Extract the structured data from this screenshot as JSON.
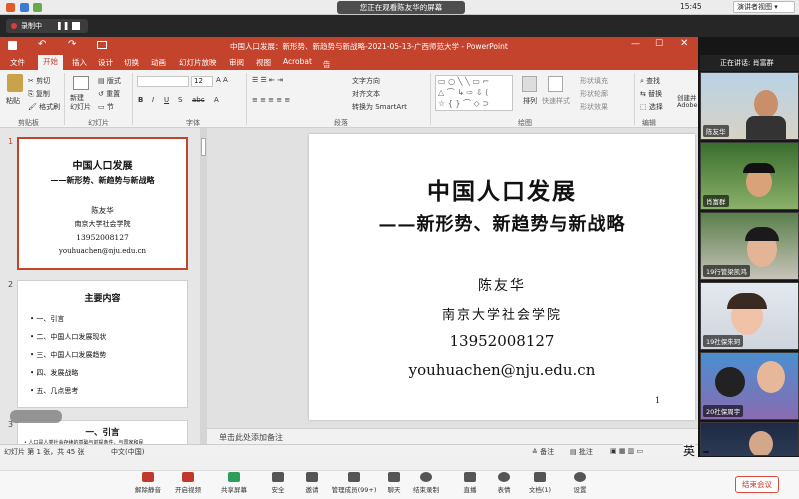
{
  "mac_bar": {
    "viewing_banner": "您正在观看陈友华的屏幕",
    "clock": "15:45",
    "view_options": "演讲者视图 ▾"
  },
  "recording": {
    "label": "录制中"
  },
  "ppt": {
    "window_title": "中国人口发展：新形势、新趋势与新战略-2021-05-13-广西师范大学 - PowerPoint",
    "tabs": [
      "文件",
      "开始",
      "插入",
      "设计",
      "切换",
      "动画",
      "幻灯片放映",
      "审阅",
      "视图",
      "Acrobat"
    ],
    "tellme": "告诉我您想要做什么...",
    "clipboard": {
      "paste": "粘贴",
      "cut": "剪切",
      "copy": "复制",
      "format_painter": "格式刷",
      "group": "剪贴板"
    },
    "slides_group": {
      "new_slide": "新建\n幻灯片",
      "layout": "版式",
      "reset": "重置",
      "section": "节",
      "group": "幻灯片"
    },
    "font_group": {
      "size": "12",
      "group": "字体"
    },
    "paragraph_group": {
      "text_direction": "文字方向",
      "align_text": "对齐文本",
      "smartart": "转换为 SmartArt",
      "group": "段落"
    },
    "drawing_group": {
      "arrange": "排列",
      "quick_styles": "快速样式",
      "fill": "形状填充",
      "outline": "形状轮廓",
      "effects": "形状效果",
      "group": "绘图"
    },
    "editing_group": {
      "find": "查找",
      "replace": "替换",
      "select": "选择",
      "group": "编辑"
    },
    "adobe": {
      "create": "创建并",
      "share": "Adobe",
      "group": "Adobe"
    },
    "notes_placeholder": "单击此处添加备注",
    "status": {
      "slide_count": "幻灯片 第 1 张，共 45 张",
      "language": "中文(中国)",
      "notes": "备注",
      "comments": "批注"
    },
    "ime": "英"
  },
  "slide1": {
    "title": "中国人口发展",
    "subtitle": "——新形势、新趋势与新战略",
    "author": "陈友华",
    "affiliation": "南京大学社会学院",
    "phone": "13952008127",
    "email": "youhuachen@nju.edu.cn",
    "page": "1"
  },
  "thumbs": {
    "n1": "1",
    "n2": "2",
    "n3": "3",
    "t2_title": "主要内容",
    "t2_items": [
      "一、引言",
      "二、中国人口发展现状",
      "三、中国人口发展趋势",
      "四、发展战略",
      "五、几点思考"
    ],
    "t3_title": "一、引言",
    "t3_line": "• 人口是人类社会存续的基础与前提条件，与国家和民"
  },
  "gallery": {
    "speaking": "正在讲话: 肖富群",
    "participants": [
      "陈友华",
      "肖富群",
      "19行管梁凯鸿",
      "19社保朱珂",
      "20社保周宇",
      ""
    ]
  },
  "zoom_toolbar": {
    "buttons": [
      "解除静音",
      "开启视频",
      "共享屏幕",
      "安全",
      "邀请",
      "管理成员(99+)",
      "聊天",
      "结束录制",
      "直播",
      "表情",
      "文档(1)",
      "设置"
    ],
    "end": "结束会议"
  }
}
